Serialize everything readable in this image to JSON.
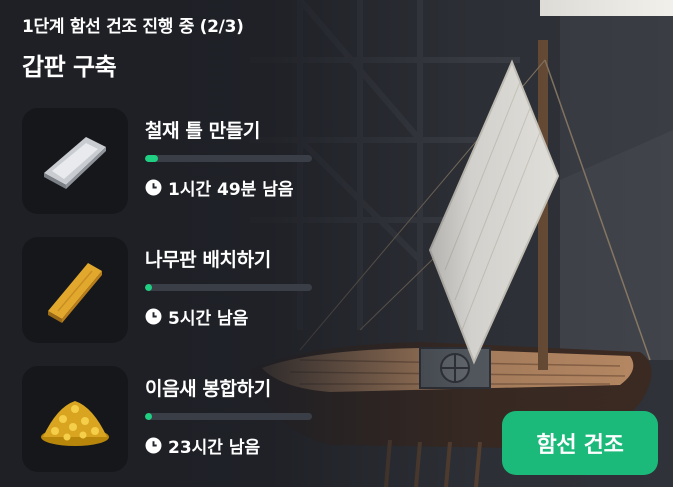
{
  "header": {
    "stage_text": "1단계 함선 건조 진행 중 (2/3)",
    "section_title": "갑판 구축"
  },
  "tasks": [
    {
      "name": "철재 틀 만들기",
      "time_left": "1시간 49분 남음",
      "progress": 0.08,
      "icon": "iron-ingot-icon"
    },
    {
      "name": "나무판 배치하기",
      "time_left": "5시간 남음",
      "progress": 0.04,
      "icon": "wood-plank-icon"
    },
    {
      "name": "이음새 봉합하기",
      "time_left": "23시간 남음",
      "progress": 0.04,
      "icon": "gold-pile-icon"
    }
  ],
  "build_button": {
    "label": "함선 건조"
  },
  "colors": {
    "accent": "#1bb97a",
    "progress": "#1fcf82"
  }
}
